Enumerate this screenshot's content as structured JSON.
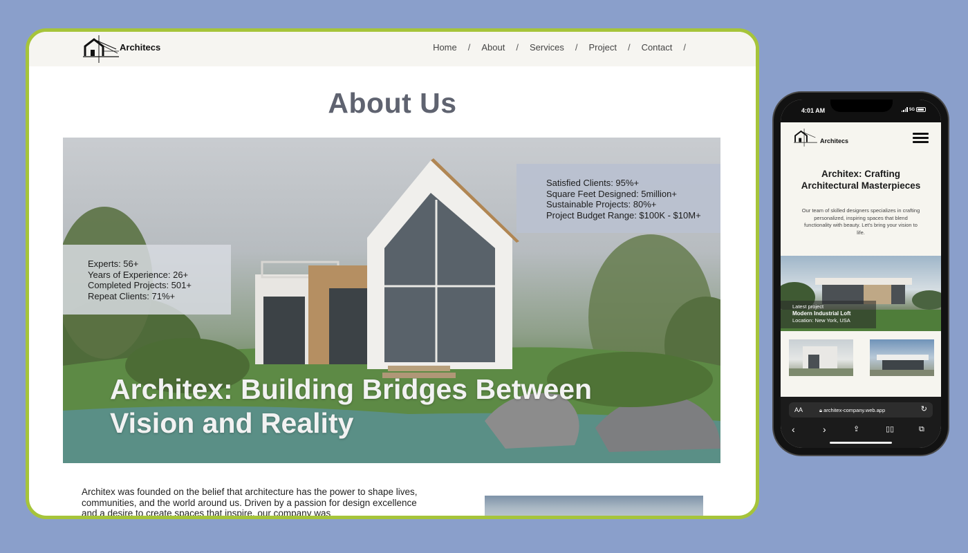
{
  "desktop": {
    "brand": "Architecs",
    "nav": [
      {
        "label": "Home"
      },
      {
        "label": "About"
      },
      {
        "label": "Services"
      },
      {
        "label": "Project"
      },
      {
        "label": "Contact"
      }
    ],
    "nav_separator": "/",
    "page_title": "About Us",
    "hero": {
      "stats_left": [
        "Experts: 56+",
        "Years of Experience: 26+",
        "Completed Projects: 501+",
        "Repeat Clients: 71%+"
      ],
      "stats_right": [
        "Satisfied Clients: 95%+",
        "Square Feet Designed: 5million+",
        "Sustainable Projects: 80%+",
        "Project Budget Range: $100K - $10M+"
      ],
      "headline": "Architex: Building Bridges Between Vision and Reality"
    },
    "body_text": "Architex was founded on the belief that architecture has the power to shape lives, communities, and the world around us. Driven by a passion for design excellence and a desire to create spaces that inspire, our company was"
  },
  "phone": {
    "time": "4:01 AM",
    "network": "5G",
    "brand": "Architecs",
    "title": "Architex: Crafting Architectural Masterpieces",
    "description": "Our team of skilled designers specializes in crafting personalized, inspiring spaces that blend functionality with beauty. Let's bring your vision to life.",
    "latest_label": "Latest project",
    "latest_name": "Modern Industrial Loft",
    "latest_location": "Location: New York, USA",
    "browser": {
      "aa": "AA",
      "url": "architex-company.web.app"
    }
  },
  "colors": {
    "background": "#8a9fcb",
    "frame_accent": "#a6c43a",
    "title_gray": "#5f6370",
    "header_bg": "#f6f5f1"
  }
}
